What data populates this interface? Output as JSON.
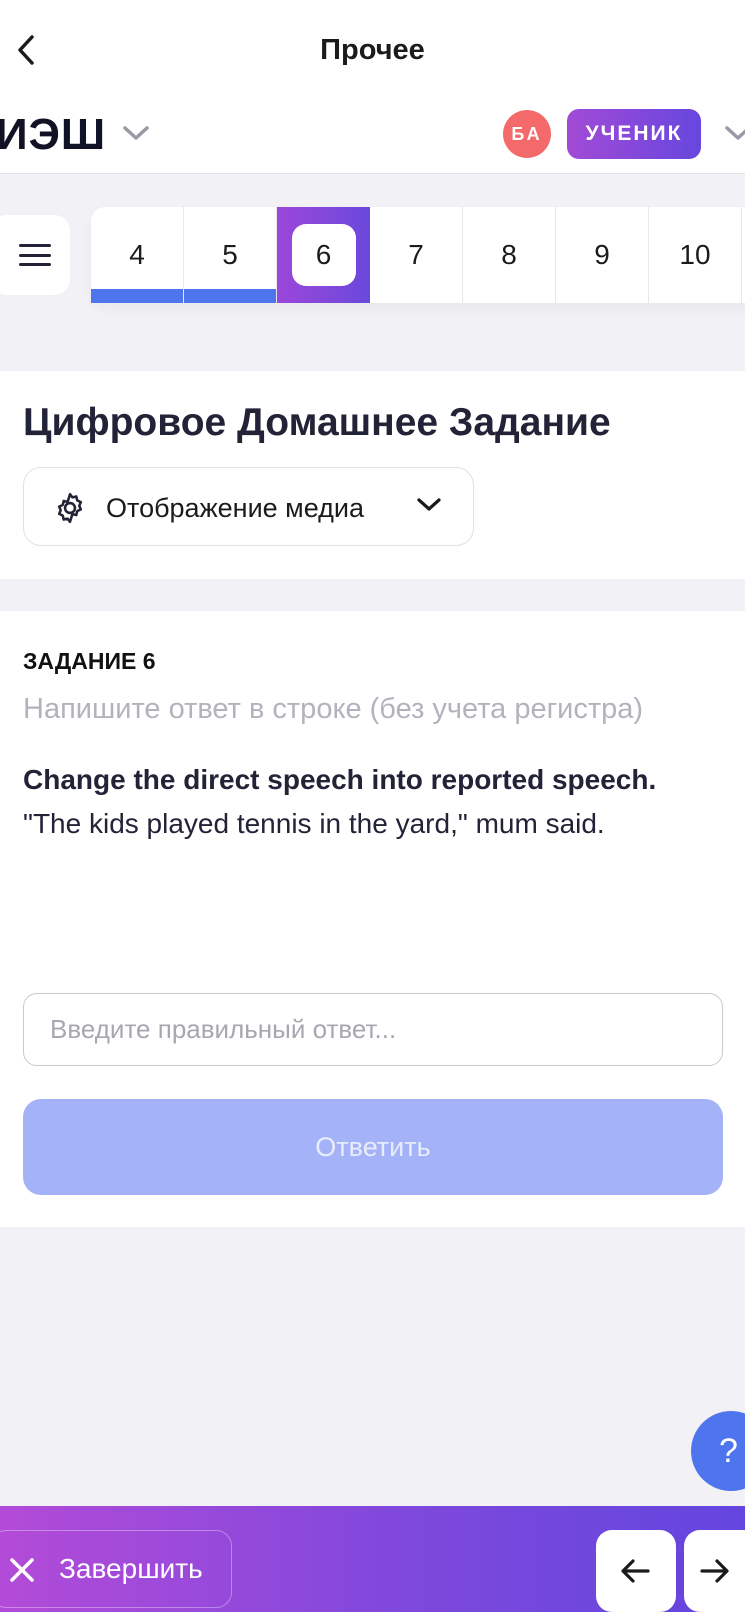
{
  "topbar": {
    "title": "Прочее"
  },
  "appbar": {
    "logo": "ИЭШ",
    "avatar_initials": "БА",
    "role_label": "УЧЕНИК"
  },
  "question_nav": {
    "items": [
      {
        "label": "4",
        "state": "completed"
      },
      {
        "label": "5",
        "state": "completed"
      },
      {
        "label": "6",
        "state": "active"
      },
      {
        "label": "7",
        "state": "default"
      },
      {
        "label": "8",
        "state": "default"
      },
      {
        "label": "9",
        "state": "default"
      },
      {
        "label": "10",
        "state": "default"
      }
    ]
  },
  "header_card": {
    "title": "Цифровое Домашнее Задание",
    "media_dropdown": {
      "icon": "gear-icon",
      "label": "Отображение медиа"
    }
  },
  "task": {
    "number_label": "ЗАДАНИЕ 6",
    "hint": "Напишите ответ в строке (без учета регистра)",
    "instruction": "Change the direct speech into reported speech.",
    "text": "\"The kids played tennis in the yard,\" mum said.",
    "answer": {
      "value": "",
      "placeholder": "Введите правильный ответ..."
    },
    "submit_label": "Ответить"
  },
  "help": {
    "label": "?"
  },
  "bottom_bar": {
    "finish_label": "Завершить"
  },
  "colors": {
    "accent_blue": "#4e75ee",
    "gradient_start": "#a24ad6",
    "gradient_end": "#6747de",
    "avatar_red": "#f46a6a",
    "submit_disabled": "#a4b3f7"
  }
}
